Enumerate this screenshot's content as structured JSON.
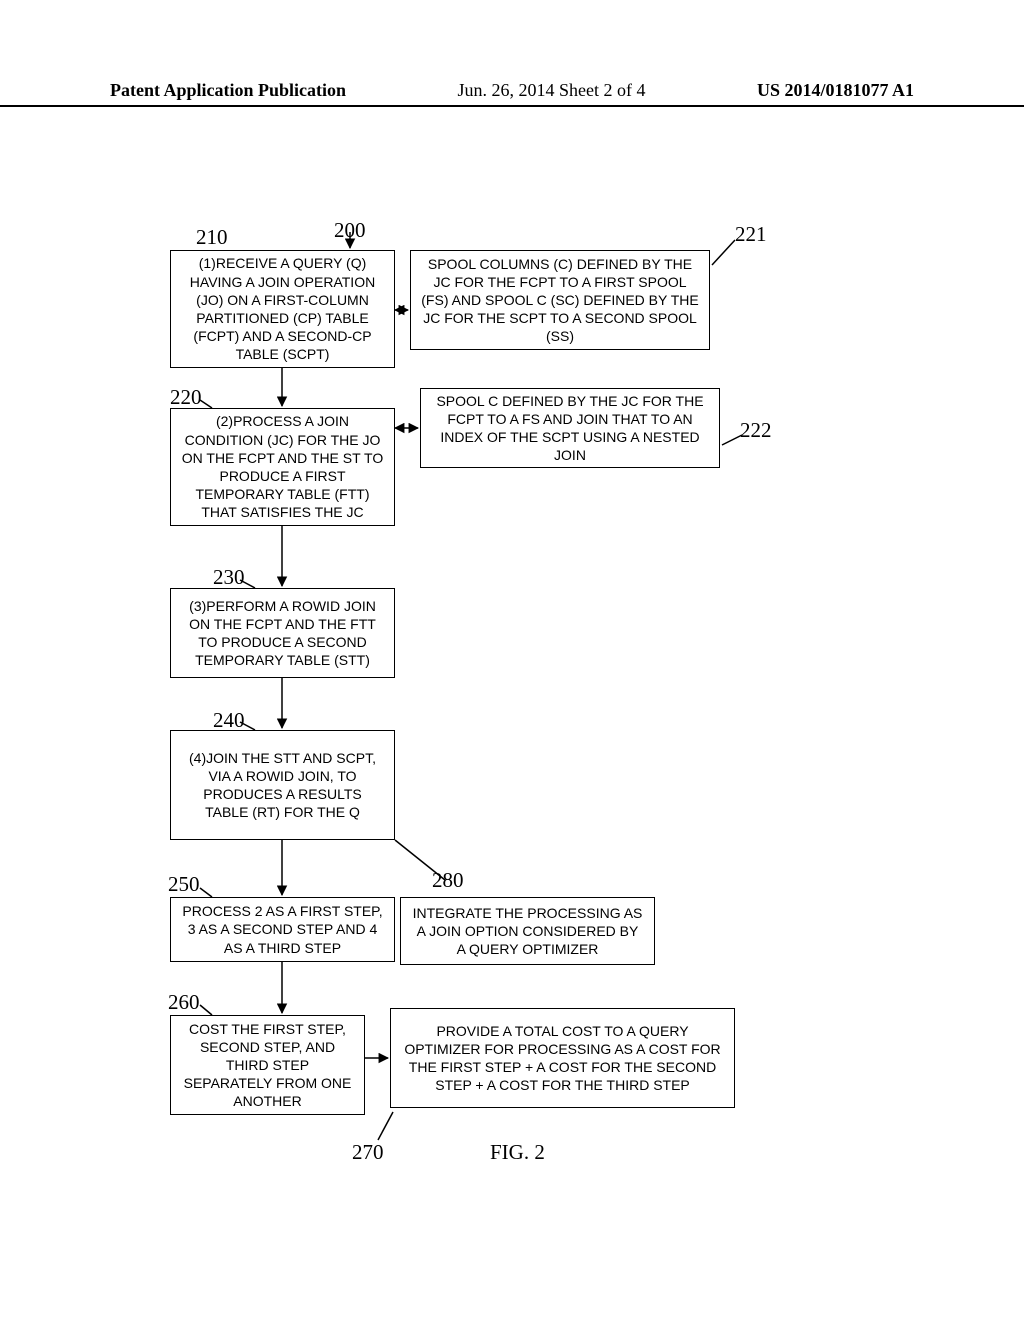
{
  "header": {
    "left": "Patent Application Publication",
    "center": "Jun. 26, 2014  Sheet 2 of 4",
    "right": "US 2014/0181077 A1"
  },
  "figure_label": "FIG. 2",
  "refs": {
    "r200": "200",
    "r210": "210",
    "r220": "220",
    "r221": "221",
    "r222": "222",
    "r230": "230",
    "r240": "240",
    "r250": "250",
    "r260": "260",
    "r270": "270",
    "r280": "280"
  },
  "boxes": {
    "b210": "(1)RECEIVE A QUERY (Q) HAVING A JOIN OPERATION (JO) ON A FIRST-COLUMN PARTITIONED (CP) TABLE (FCPT) AND A SECOND-CP TABLE (SCPT)",
    "b220": "(2)PROCESS A JOIN CONDITION (JC) FOR THE JO ON THE FCPT AND THE ST TO PRODUCE A FIRST TEMPORARY TABLE (FTT) THAT SATISFIES THE JC",
    "b221": "SPOOL COLUMNS (C) DEFINED BY THE JC FOR THE FCPT TO A FIRST SPOOL (FS) AND SPOOL C (SC) DEFINED BY THE JC FOR THE SCPT TO A SECOND SPOOL (SS)",
    "b222": "SPOOL C DEFINED BY THE JC FOR THE FCPT TO A FS AND JOIN THAT TO AN INDEX OF THE SCPT USING A NESTED JOIN",
    "b230": "(3)PERFORM A ROWID JOIN ON THE FCPT AND THE FTT TO PRODUCE A SECOND TEMPORARY TABLE (STT)",
    "b240": "(4)JOIN THE STT AND SCPT, VIA A ROWID JOIN, TO PRODUCES A RESULTS TABLE (RT) FOR THE Q",
    "b250": "PROCESS 2 AS A FIRST STEP, 3 AS A SECOND STEP AND 4 AS A THIRD STEP",
    "b260": "COST THE FIRST STEP, SECOND STEP, AND THIRD STEP SEPARATELY FROM ONE ANOTHER",
    "b270": "PROVIDE A TOTAL COST TO A QUERY OPTIMIZER FOR PROCESSING AS A COST FOR THE FIRST STEP + A COST FOR THE SECOND STEP + A COST FOR THE THIRD STEP",
    "b280": "INTEGRATE THE PROCESSING AS A JOIN OPTION CONSIDERED BY A QUERY OPTIMIZER"
  }
}
